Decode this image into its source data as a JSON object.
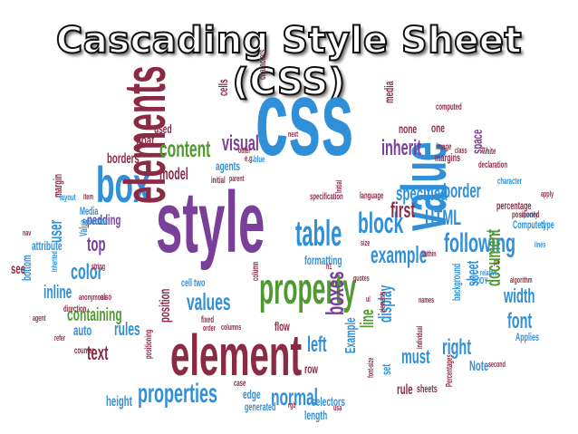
{
  "title": "Cascading Style Sheet (CSS)",
  "words": [
    {
      "t": "css",
      "c": "#2f8fd8"
    },
    {
      "t": "style",
      "c": "#7a3f99"
    },
    {
      "t": "box",
      "c": "#2f8fd8"
    },
    {
      "t": "elements",
      "c": "#8b2a45"
    },
    {
      "t": "element",
      "c": "#8b2a45"
    },
    {
      "t": "property",
      "c": "#4f9a2f"
    },
    {
      "t": "value",
      "c": "#2f8fd8"
    },
    {
      "t": "properties",
      "c": "#2f8fd8"
    },
    {
      "t": "table",
      "c": "#2f8fd8"
    },
    {
      "t": "block",
      "c": "#2f8fd8"
    },
    {
      "t": "example",
      "c": "#2f8fd8"
    },
    {
      "t": "following",
      "c": "#2f8fd8"
    },
    {
      "t": "content",
      "c": "#4f9a2f"
    },
    {
      "t": "visual",
      "c": "#7a3f99"
    },
    {
      "t": "inherit",
      "c": "#7a3f99"
    },
    {
      "t": "specified",
      "c": "#2f8fd8"
    },
    {
      "t": "border",
      "c": "#2f8fd8"
    },
    {
      "t": "HTML",
      "c": "#2f8fd8"
    },
    {
      "t": "first",
      "c": "#8b2a45"
    },
    {
      "t": "width",
      "c": "#2f8fd8"
    },
    {
      "t": "font",
      "c": "#2f8fd8"
    },
    {
      "t": "document",
      "c": "#4f9a2f"
    },
    {
      "t": "sheet",
      "c": "#2f8fd8"
    },
    {
      "t": "color",
      "c": "#2f8fd8"
    },
    {
      "t": "values",
      "c": "#2f8fd8"
    },
    {
      "t": "boxes",
      "c": "#7a3f99"
    },
    {
      "t": "left",
      "c": "#2f8fd8"
    },
    {
      "t": "right",
      "c": "#2f8fd8"
    },
    {
      "t": "line",
      "c": "#4f9a2f"
    },
    {
      "t": "normal",
      "c": "#2f8fd8"
    },
    {
      "t": "display",
      "c": "#2f8fd8"
    },
    {
      "t": "must",
      "c": "#2f8fd8"
    },
    {
      "t": "rules",
      "c": "#2f8fd8"
    },
    {
      "t": "text",
      "c": "#8b2a45"
    },
    {
      "t": "top",
      "c": "#7a3f99"
    },
    {
      "t": "user",
      "c": "#2f8fd8"
    },
    {
      "t": "inline",
      "c": "#2f8fd8"
    },
    {
      "t": "containing",
      "c": "#4f9a2f"
    },
    {
      "t": "model",
      "c": "#8b2a45"
    },
    {
      "t": "float",
      "c": "#8b2a45"
    },
    {
      "t": "borders",
      "c": "#8b2a45"
    },
    {
      "t": "used",
      "c": "#8b2a45"
    },
    {
      "t": "agents",
      "c": "#2f8fd8"
    },
    {
      "t": "none",
      "c": "#8b2a45"
    },
    {
      "t": "one",
      "c": "#8b2a45"
    },
    {
      "t": "media",
      "c": "#8b2a45"
    },
    {
      "t": "cells",
      "c": "#8b2a45"
    },
    {
      "t": "position",
      "c": "#8b2a45"
    },
    {
      "t": "padding",
      "c": "#7a3f99"
    },
    {
      "t": "height",
      "c": "#2f8fd8"
    },
    {
      "t": "edge",
      "c": "#2f8fd8"
    },
    {
      "t": "row",
      "c": "#8b2a45"
    },
    {
      "t": "set",
      "c": "#2f8fd8"
    },
    {
      "t": "rule",
      "c": "#8b2a45"
    },
    {
      "t": "length",
      "c": "#2f8fd8"
    },
    {
      "t": "selectors",
      "c": "#2f8fd8"
    },
    {
      "t": "flow",
      "c": "#8b2a45"
    },
    {
      "t": "Note",
      "c": "#2f8fd8"
    },
    {
      "t": "auto",
      "c": "#2f8fd8"
    },
    {
      "t": "see",
      "c": "#8b2a45"
    },
    {
      "t": "bottom",
      "c": "#2f8fd8"
    },
    {
      "t": "attribute",
      "c": "#2f8fd8"
    },
    {
      "t": "margin",
      "c": "#8b2a45"
    },
    {
      "t": "Value",
      "c": "#2f8fd8"
    },
    {
      "t": "selector",
      "c": "#2f8fd8"
    },
    {
      "t": "Example",
      "c": "#2f8fd8"
    },
    {
      "t": "formatting",
      "c": "#2f8fd8"
    },
    {
      "t": "background",
      "c": "#2f8fd8"
    },
    {
      "t": "cell two",
      "c": "#2f8fd8"
    },
    {
      "t": "space",
      "c": "#7a3f99"
    },
    {
      "t": "margins",
      "c": "#8b2a45"
    },
    {
      "t": "percentage",
      "c": "#8b2a45"
    },
    {
      "t": "Computed",
      "c": "#2f8fd8"
    },
    {
      "t": "type",
      "c": "#2f8fd8"
    },
    {
      "t": "specification",
      "c": "#8b2a45"
    },
    {
      "t": "language",
      "c": "#8b2a45"
    },
    {
      "t": "characters",
      "c": "#8b2a45"
    },
    {
      "t": "positioning",
      "c": "#8b2a45"
    },
    {
      "t": "generated",
      "c": "#2f8fd8"
    },
    {
      "t": "Applies",
      "c": "#2f8fd8"
    },
    {
      "t": "Percentages",
      "c": "#8b2a45"
    },
    {
      "t": "sheets",
      "c": "#8b2a45"
    },
    {
      "t": "column",
      "c": "#8b2a45"
    },
    {
      "t": "initial",
      "c": "#8b2a45"
    },
    {
      "t": "Media",
      "c": "#2f8fd8"
    },
    {
      "t": "BODY",
      "c": "#2f8fd8"
    },
    {
      "t": "image",
      "c": "#8b2a45"
    },
    {
      "t": "white",
      "c": "#8b2a45"
    },
    {
      "t": "computed",
      "c": "#8b2a45"
    },
    {
      "t": "character",
      "c": "#2f8fd8"
    },
    {
      "t": "declaration",
      "c": "#8b2a45"
    },
    {
      "t": "fixed",
      "c": "#8b2a45"
    },
    {
      "t": "direction",
      "c": "#8b2a45"
    },
    {
      "t": "counter",
      "c": "#8b2a45"
    },
    {
      "t": "layout",
      "c": "#2f8fd8"
    },
    {
      "t": "names",
      "c": "#8b2a45"
    },
    {
      "t": "second",
      "c": "#8b2a45"
    },
    {
      "t": "case",
      "c": "#8b2a45"
    },
    {
      "t": "order",
      "c": "#8b2a45"
    },
    {
      "t": "columns",
      "c": "#8b2a45"
    },
    {
      "t": "anonymous",
      "c": "#8b2a45"
    },
    {
      "t": "also",
      "c": "#8b2a45"
    },
    {
      "t": "string",
      "c": "#8b2a45"
    },
    {
      "t": "item",
      "c": "#8b2a45"
    },
    {
      "t": "agent",
      "c": "#8b2a45"
    },
    {
      "t": "specify",
      "c": "#2f8fd8"
    },
    {
      "t": "lines",
      "c": "#2f8fd8"
    },
    {
      "t": "algorithm",
      "c": "#8b2a45"
    },
    {
      "t": "relative",
      "c": "#2f8fd8"
    },
    {
      "t": "apply",
      "c": "#8b2a45"
    },
    {
      "t": "positioned",
      "c": "#8b2a45"
    },
    {
      "t": "quotes",
      "c": "#8b2a45"
    },
    {
      "t": "font-size",
      "c": "#8b2a45"
    },
    {
      "t": "individual",
      "c": "#8b2a45"
    },
    {
      "t": "elements",
      "c": "#8b2a45"
    },
    {
      "t": "size",
      "c": "#8b2a45"
    },
    {
      "t": "next",
      "c": "#8b2a45"
    },
    {
      "t": "class",
      "c": "#8b2a45"
    },
    {
      "t": "parent",
      "c": "#8b2a45"
    },
    {
      "t": "outer",
      "c": "#8b2a45"
    },
    {
      "t": "e.g.",
      "c": "#8b2a45"
    },
    {
      "t": "blue",
      "c": "#2f8fd8"
    },
    {
      "t": "within",
      "c": "#8b2a45"
    },
    {
      "t": "Initial",
      "c": "#8b2a45"
    },
    {
      "t": "Inherited",
      "c": "#2f8fd8"
    },
    {
      "t": "refer",
      "c": "#8b2a45"
    },
    {
      "t": "nav",
      "c": "#8b2a45"
    },
    {
      "t": "ul",
      "c": "#8b2a45"
    },
    {
      "t": "h1",
      "c": "#8b2a45"
    },
    {
      "t": "rgb",
      "c": "#8b2a45"
    },
    {
      "t": "usa",
      "c": "#8b2a45"
    },
    {
      "t": "px",
      "c": "#8b2a45"
    }
  ]
}
